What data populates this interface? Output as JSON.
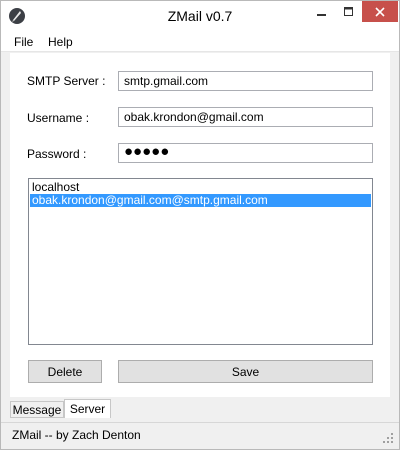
{
  "window": {
    "title": "ZMail v0.7",
    "app_icon": "feather-pen-icon"
  },
  "menu": {
    "items": [
      {
        "label": "File"
      },
      {
        "label": "Help"
      }
    ]
  },
  "form": {
    "smtp_label": "SMTP Server :",
    "smtp_value": "smtp.gmail.com",
    "username_label": "Username :",
    "username_value": "obak.krondon@gmail.com",
    "password_label": "Password :",
    "password_value": "●●●●●"
  },
  "accounts": {
    "items": [
      {
        "label": "localhost",
        "selected": false
      },
      {
        "label": "obak.krondon@gmail.com@smtp.gmail.com",
        "selected": true
      }
    ]
  },
  "buttons": {
    "delete": "Delete",
    "save": "Save"
  },
  "tabs": [
    {
      "label": "Message",
      "active": false
    },
    {
      "label": "Server",
      "active": true
    }
  ],
  "status": {
    "text": "ZMail -- by Zach Denton"
  },
  "colors": {
    "selection": "#3399ff",
    "close_button": "#c7504b"
  }
}
